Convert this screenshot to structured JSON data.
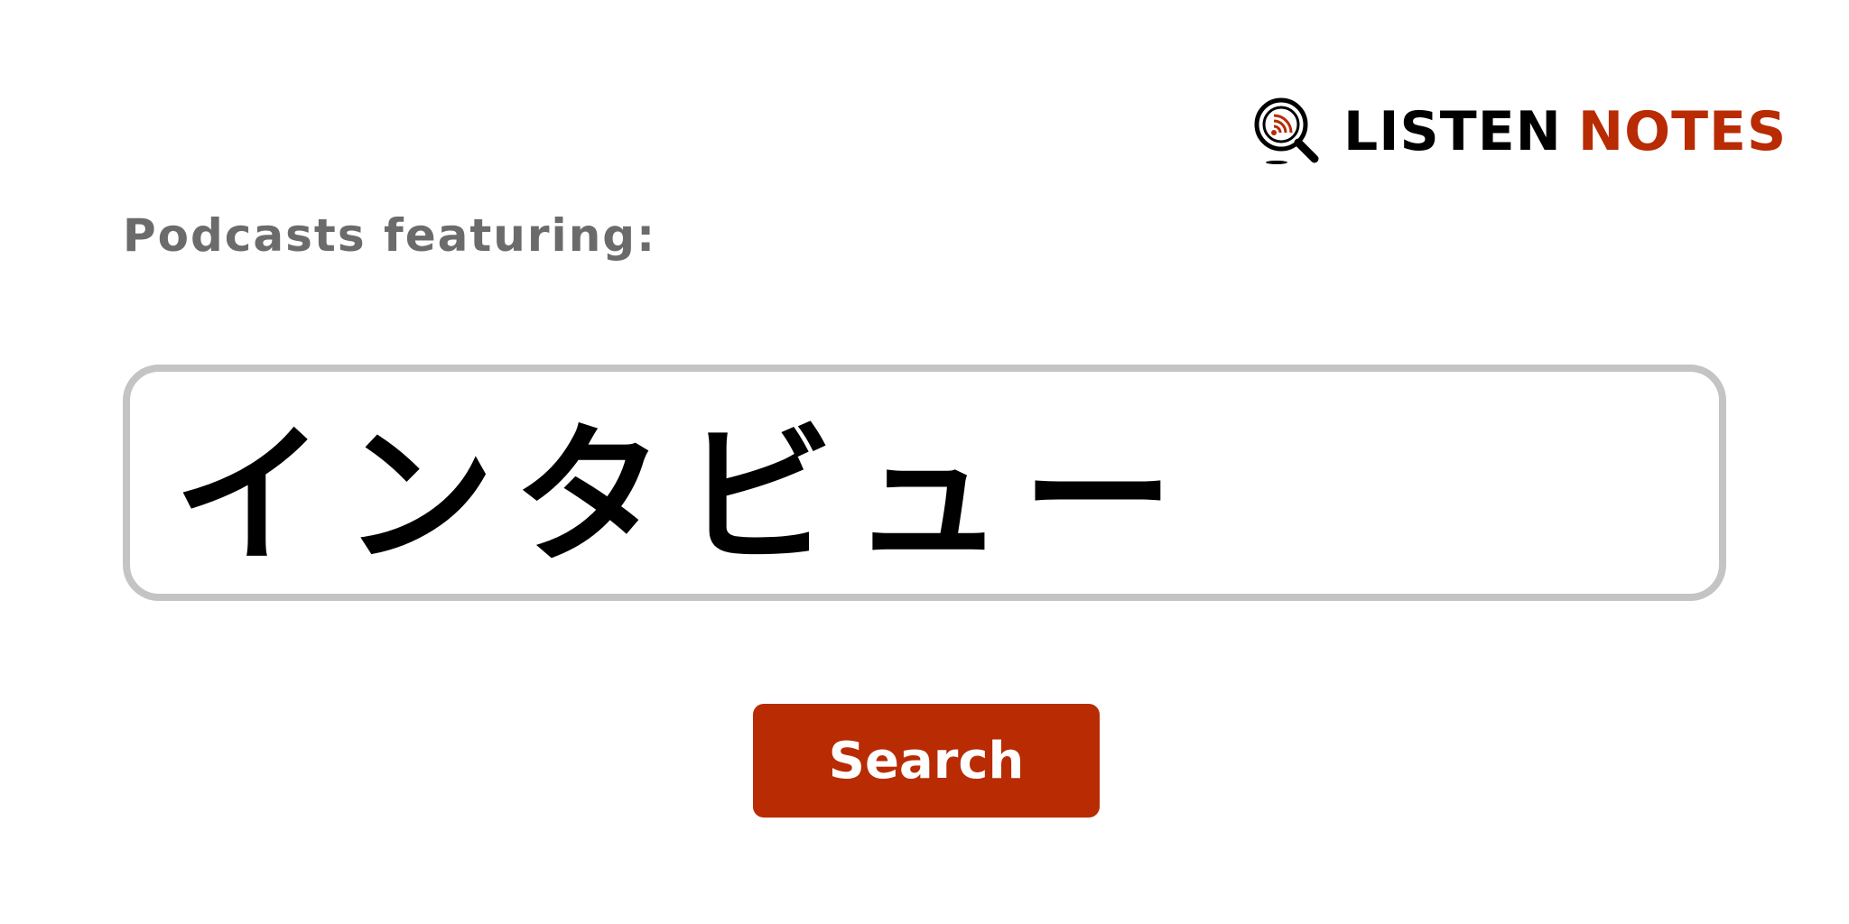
{
  "logo": {
    "word1": "LISTEN",
    "word2": "NOTES",
    "icon": "magnifier-rss-icon",
    "brand_color": "#b82b03"
  },
  "heading": "Podcasts featuring:",
  "search": {
    "value": "インタビュー"
  },
  "button": {
    "label": "Search"
  },
  "colors": {
    "accent": "#b82b03",
    "heading_text": "#6b6b6b",
    "input_border": "#c4c4c4"
  }
}
